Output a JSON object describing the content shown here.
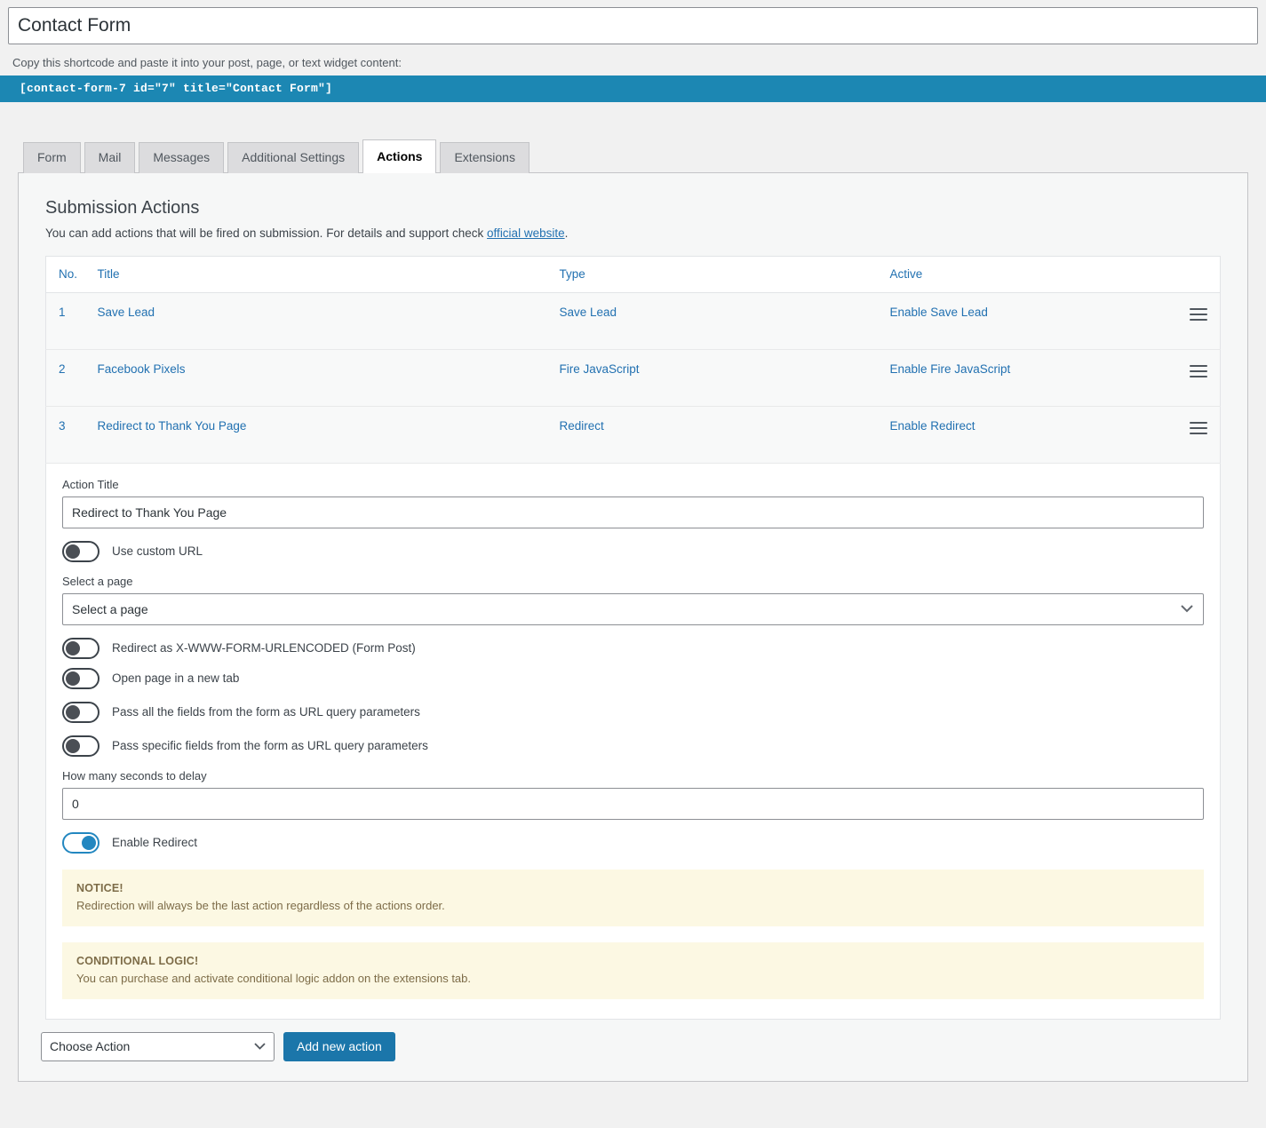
{
  "form_title": "Contact Form",
  "shortcode": {
    "help": "Copy this shortcode and paste it into your post, page, or text widget content:",
    "code": "[contact-form-7 id=\"7\" title=\"Contact Form\"]"
  },
  "tabs": [
    {
      "label": "Form",
      "active": false
    },
    {
      "label": "Mail",
      "active": false
    },
    {
      "label": "Messages",
      "active": false
    },
    {
      "label": "Additional Settings",
      "active": false
    },
    {
      "label": "Actions",
      "active": true
    },
    {
      "label": "Extensions",
      "active": false
    }
  ],
  "section": {
    "title": "Submission Actions",
    "description_before": "You can add actions that will be fired on submission. For details and support check ",
    "link_text": "official website",
    "description_after": "."
  },
  "table": {
    "headers": {
      "no": "No.",
      "title": "Title",
      "type": "Type",
      "active": "Active"
    },
    "rows": [
      {
        "no": "1",
        "title": "Save Lead",
        "type": "Save Lead",
        "active": "Enable Save Lead"
      },
      {
        "no": "2",
        "title": "Facebook Pixels",
        "type": "Fire JavaScript",
        "active": "Enable Fire JavaScript"
      },
      {
        "no": "3",
        "title": "Redirect to Thank You Page",
        "type": "Redirect",
        "active": "Enable Redirect"
      }
    ]
  },
  "editor": {
    "action_title_label": "Action Title",
    "action_title_value": "Redirect to Thank You Page",
    "use_custom_url_label": "Use custom URL",
    "select_page_label": "Select a page",
    "select_page_value": "Select a page",
    "toggle_urlencoded_label": "Redirect as X-WWW-FORM-URLENCODED (Form Post)",
    "toggle_new_tab_label": "Open page in a new tab",
    "toggle_pass_all_label": "Pass all the fields from the form as URL query parameters",
    "toggle_pass_specific_label": "Pass specific fields from the form as URL query parameters",
    "delay_label": "How many seconds to delay",
    "delay_value": "0",
    "enable_redirect_label": "Enable Redirect",
    "notice": {
      "title": "NOTICE!",
      "text": "Redirection will always be the last action regardless of the actions order."
    },
    "conditional": {
      "title": "CONDITIONAL LOGIC!",
      "text": "You can purchase and activate conditional logic addon on the extensions tab."
    }
  },
  "bottom": {
    "choose_action_value": "Choose Action",
    "add_button_label": "Add new action"
  },
  "colors": {
    "accent_blue": "#1c87b3",
    "link_blue": "#2271b1",
    "notice_bg": "#fcf8e3",
    "notice_text": "#7d6c48",
    "button_blue": "#1b76aa"
  }
}
